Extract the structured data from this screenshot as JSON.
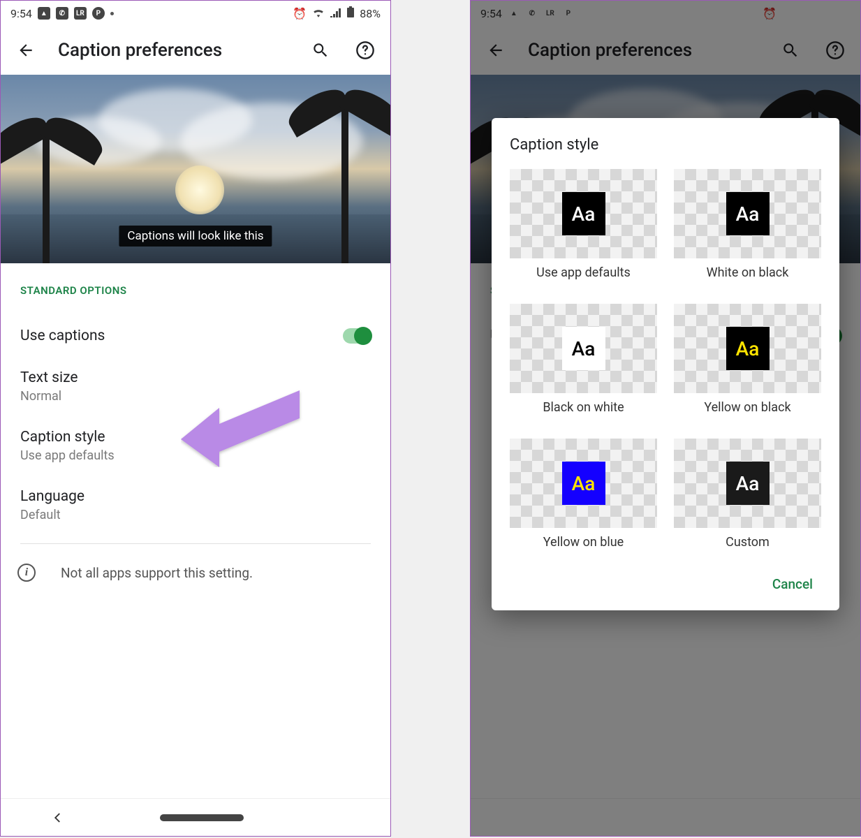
{
  "status": {
    "time": "9:54",
    "battery": "88%"
  },
  "appbar": {
    "title": "Caption preferences"
  },
  "preview": {
    "caption_text": "Captions will look like this"
  },
  "section_label": "STANDARD OPTIONS",
  "rows": {
    "use_captions": "Use captions",
    "text_size": {
      "title": "Text size",
      "sub": "Normal"
    },
    "caption_style": {
      "title": "Caption style",
      "sub": "Use app defaults"
    },
    "language": {
      "title": "Language",
      "sub": "Default"
    }
  },
  "info_text": "Not all apps support this setting.",
  "dialog": {
    "title": "Caption style",
    "options": [
      "Use app defaults",
      "White on black",
      "Black on white",
      "Yellow on black",
      "Yellow on blue",
      "Custom"
    ],
    "cancel": "Cancel"
  },
  "swatch_text": "Aa"
}
